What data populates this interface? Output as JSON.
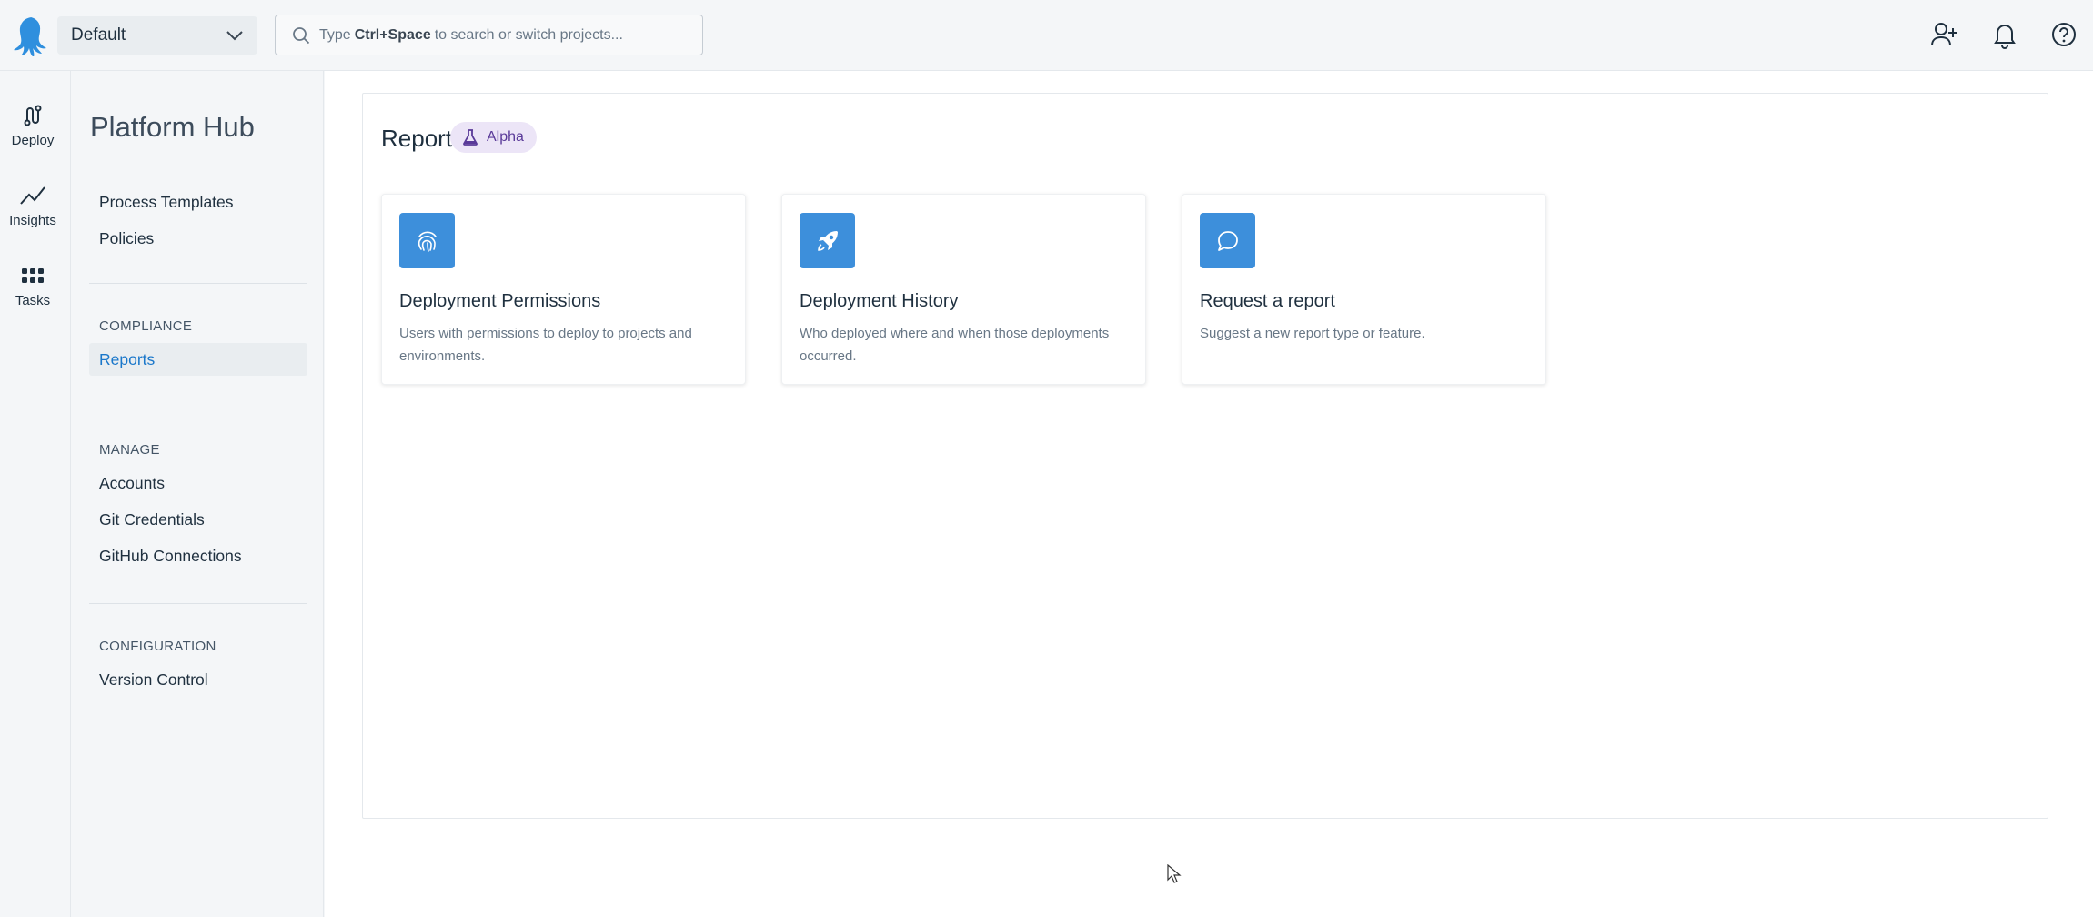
{
  "header": {
    "space_name": "Default",
    "search": {
      "prefix": "Type",
      "shortcut": "Ctrl+Space",
      "suffix": "to search or switch projects..."
    }
  },
  "rail": {
    "items": [
      {
        "label": "Deploy",
        "icon": "deploy-icon"
      },
      {
        "label": "Insights",
        "icon": "insights-icon"
      },
      {
        "label": "Tasks",
        "icon": "tasks-icon"
      }
    ]
  },
  "sidebar": {
    "title": "Platform Hub",
    "top_links": [
      "Process Templates",
      "Policies"
    ],
    "sections": [
      {
        "heading": "COMPLIANCE",
        "items": [
          "Reports"
        ]
      },
      {
        "heading": "MANAGE",
        "items": [
          "Accounts",
          "Git Credentials",
          "GitHub Connections"
        ]
      },
      {
        "heading": "CONFIGURATION",
        "items": [
          "Version Control"
        ]
      }
    ],
    "active_item": "Reports"
  },
  "main": {
    "title": "Reports",
    "badge": "Alpha",
    "cards": [
      {
        "title": "Deployment Permissions",
        "description": "Users with permissions to deploy to projects and environments.",
        "icon": "fingerprint-icon"
      },
      {
        "title": "Deployment History",
        "description": "Who deployed where and when those deployments occurred.",
        "icon": "rocket-icon"
      },
      {
        "title": "Request a report",
        "description": "Suggest a new report type or feature.",
        "icon": "chat-bubble-icon"
      }
    ]
  },
  "colors": {
    "accent": "#1a77ca",
    "card_icon_bg": "#3d8fdb",
    "badge_bg": "#ece5f7",
    "badge_text": "#5a3a99"
  }
}
